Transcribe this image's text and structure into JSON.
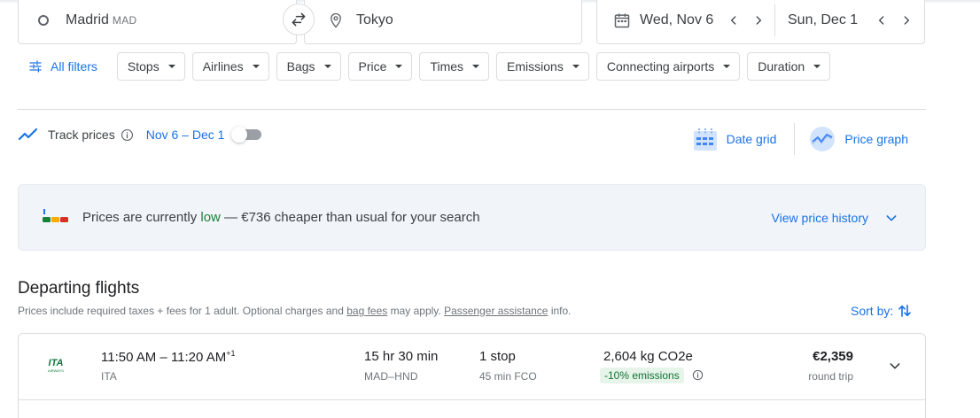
{
  "search": {
    "origin": {
      "city": "Madrid",
      "code": "MAD"
    },
    "destination": {
      "city": "Tokyo"
    },
    "depart_date": "Wed, Nov 6",
    "return_date": "Sun, Dec 1"
  },
  "filters": {
    "all_filters_label": "All filters",
    "chips": [
      "Stops",
      "Airlines",
      "Bags",
      "Price",
      "Times",
      "Emissions",
      "Connecting airports",
      "Duration"
    ]
  },
  "track": {
    "label": "Track prices",
    "dates": "Nov 6 – Dec 1",
    "enabled": false,
    "date_grid_label": "Date grid",
    "price_graph_label": "Price graph"
  },
  "insight": {
    "prefix": "Prices are currently ",
    "level": "low",
    "suffix": " — €736 cheaper than usual for your search",
    "link": "View price history"
  },
  "departing": {
    "title": "Departing flights",
    "note_before": "Prices include required taxes + fees for 1 adult. Optional charges and ",
    "bag_fees": "bag fees",
    "note_middle": " may apply. ",
    "passenger_assistance": "Passenger assistance",
    "note_after": " info.",
    "sort_label": "Sort by:"
  },
  "flights": [
    {
      "times": "11:50 AM – 11:20 AM",
      "day_offset": "+1",
      "carrier": "ITA",
      "logo_text": "ITA",
      "logo_sub": "AIRWAYS",
      "duration": "15 hr 30 min",
      "route": "MAD–HND",
      "stops": "1 stop",
      "layover": "45 min FCO",
      "emissions": "2,604 kg CO2e",
      "emissions_badge": "-10% emissions",
      "price": "€2,359",
      "price_type": "round trip"
    }
  ],
  "colors": {
    "accent": "#1a73e8",
    "low_price": "#188038",
    "insight_bg": "#f1f5fa",
    "emissions_badge_bg": "#e6f4ea",
    "ita_green": "#0f7b3f"
  }
}
